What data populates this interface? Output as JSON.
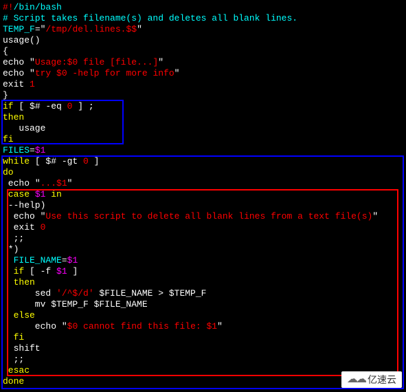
{
  "lines": {
    "l1a": "#!",
    "l1b": "/bin/bash",
    "l2": "# Script takes filename(s) and deletes all blank lines.",
    "l3a": "TEMP_F",
    "l3b": "=",
    "l3c": "\"",
    "l3d": "/tmp/del.lines.$$",
    "l3e": "\"",
    "l4": "usage()",
    "l5": "{",
    "l6a": "echo ",
    "l6b": "\"",
    "l6c": "Usage:$0 file [file...]",
    "l6d": "\"",
    "l7a": "echo ",
    "l7b": "\"",
    "l7c": "try $0 -help for more info",
    "l7d": "\"",
    "l8a": "exit ",
    "l8b": "1",
    "l9": "}",
    "l10a": "if",
    "l10b": " [ $# -eq ",
    "l10c": "0",
    "l10d": " ] ;",
    "l11": "then",
    "l12": "   usage",
    "l13": "fi",
    "l14a": "FILES",
    "l14b": "=",
    "l14c": "$1",
    "l15a": "while",
    "l15b": " [ $# -gt ",
    "l15c": "0",
    "l15d": " ]",
    "l16": "do",
    "l17a": " echo ",
    "l17b": "\"",
    "l17c": "...$1",
    "l17d": "\"",
    "l18a": " case ",
    "l18b": "$1",
    "l18c": " in",
    "l19": " --help)",
    "l20a": "  echo ",
    "l20b": "\"",
    "l20c": "Use this script to delete all blank lines from a text file(s)",
    "l20d": "\"",
    "l21a": "  exit ",
    "l21b": "0",
    "l22": "  ;;",
    "l23": " *)",
    "l24a": "  FILE_NAME",
    "l24b": "=",
    "l24c": "$1",
    "l25a": "  if",
    "l25b": " [ -f ",
    "l25c": "$1",
    "l25d": " ]",
    "l26": "  then",
    "l27a": "      sed ",
    "l27b": "'/^$/d'",
    "l27c": " $FILE_NAME > $TEMP_F",
    "l28": "      mv $TEMP_F $FILE_NAME",
    "l29": "  else",
    "l30a": "      echo ",
    "l30b": "\"",
    "l30c": "$0 cannot find this file: $1",
    "l30d": "\"",
    "l31": "  fi",
    "l32": "  shift",
    "l33": "  ;;",
    "l34": " esac",
    "l35": "done"
  },
  "watermark": "亿速云"
}
